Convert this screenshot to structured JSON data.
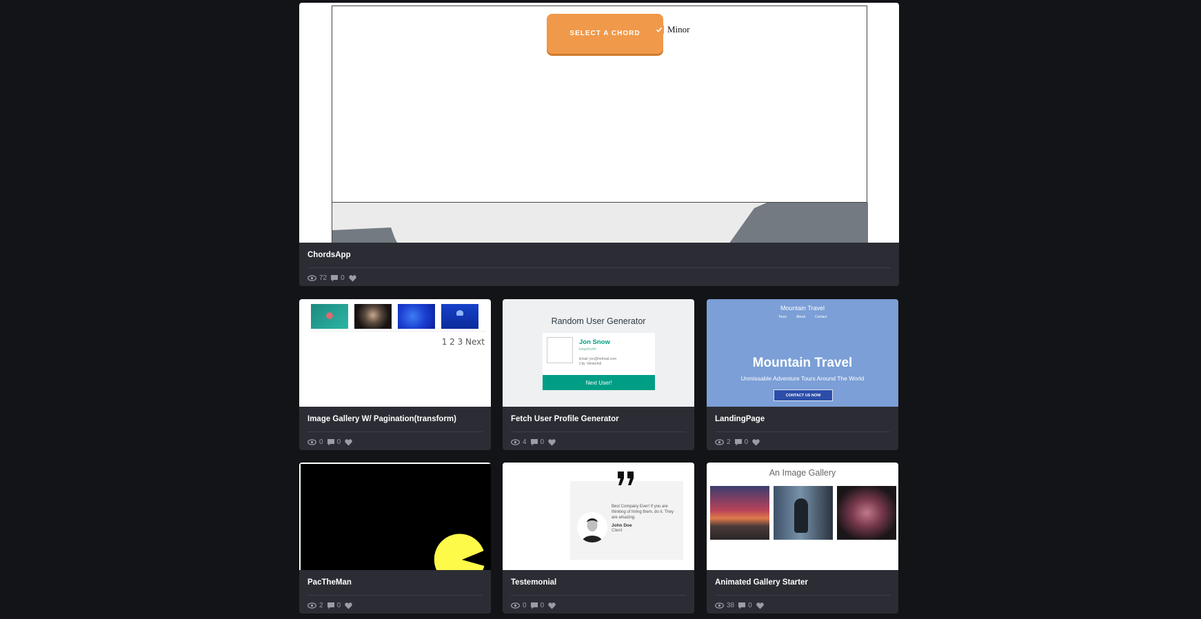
{
  "cards": [
    {
      "title": "ChordsApp",
      "views": "72",
      "comments": "0",
      "preview": {
        "button": "SELECT A CHORD",
        "checkbox_label": "Minor"
      }
    },
    {
      "title": "Image Gallery W/ Pagination(transform)",
      "views": "0",
      "comments": "0",
      "preview": {
        "pagination": "1 2 3 Next"
      }
    },
    {
      "title": "Fetch User Profile Generator",
      "views": "4",
      "comments": "0",
      "preview": {
        "heading": "Random User Generator",
        "name": "Jon Snow",
        "username": "kingofnorth",
        "email": "Email: jon@hotmail.com",
        "city": "City: Winterfell",
        "button": "Next User!"
      }
    },
    {
      "title": "LandingPage",
      "views": "2",
      "comments": "0",
      "preview": {
        "brand": "Mountain Travel",
        "nav": [
          "Tours",
          "About",
          "Contact"
        ],
        "hero_title": "Mountain Travel",
        "hero_sub": "Unmissable Adventure Tours Around The World",
        "cta": "CONTACT US NOW"
      }
    },
    {
      "title": "PacTheMan",
      "views": "2",
      "comments": "0",
      "preview": {}
    },
    {
      "title": "Testemonial",
      "views": "0",
      "comments": "0",
      "preview": {
        "quote": "Best Company Ever! If you are thinking of hiring them, do it. They are amazing.",
        "name": "John Doe",
        "role": "Client"
      }
    },
    {
      "title": "Animated Gallery Starter",
      "views": "38",
      "comments": "0",
      "preview": {
        "heading": "An Image Gallery"
      }
    }
  ],
  "icons": {
    "views": "eye-icon",
    "comments": "comment-icon",
    "likes": "heart-icon"
  },
  "colors": {
    "background": "#131417",
    "card": "#2c2d34",
    "accent": "#f0994a",
    "teal": "#009e85",
    "landing_blue": "#7b9fd6"
  }
}
